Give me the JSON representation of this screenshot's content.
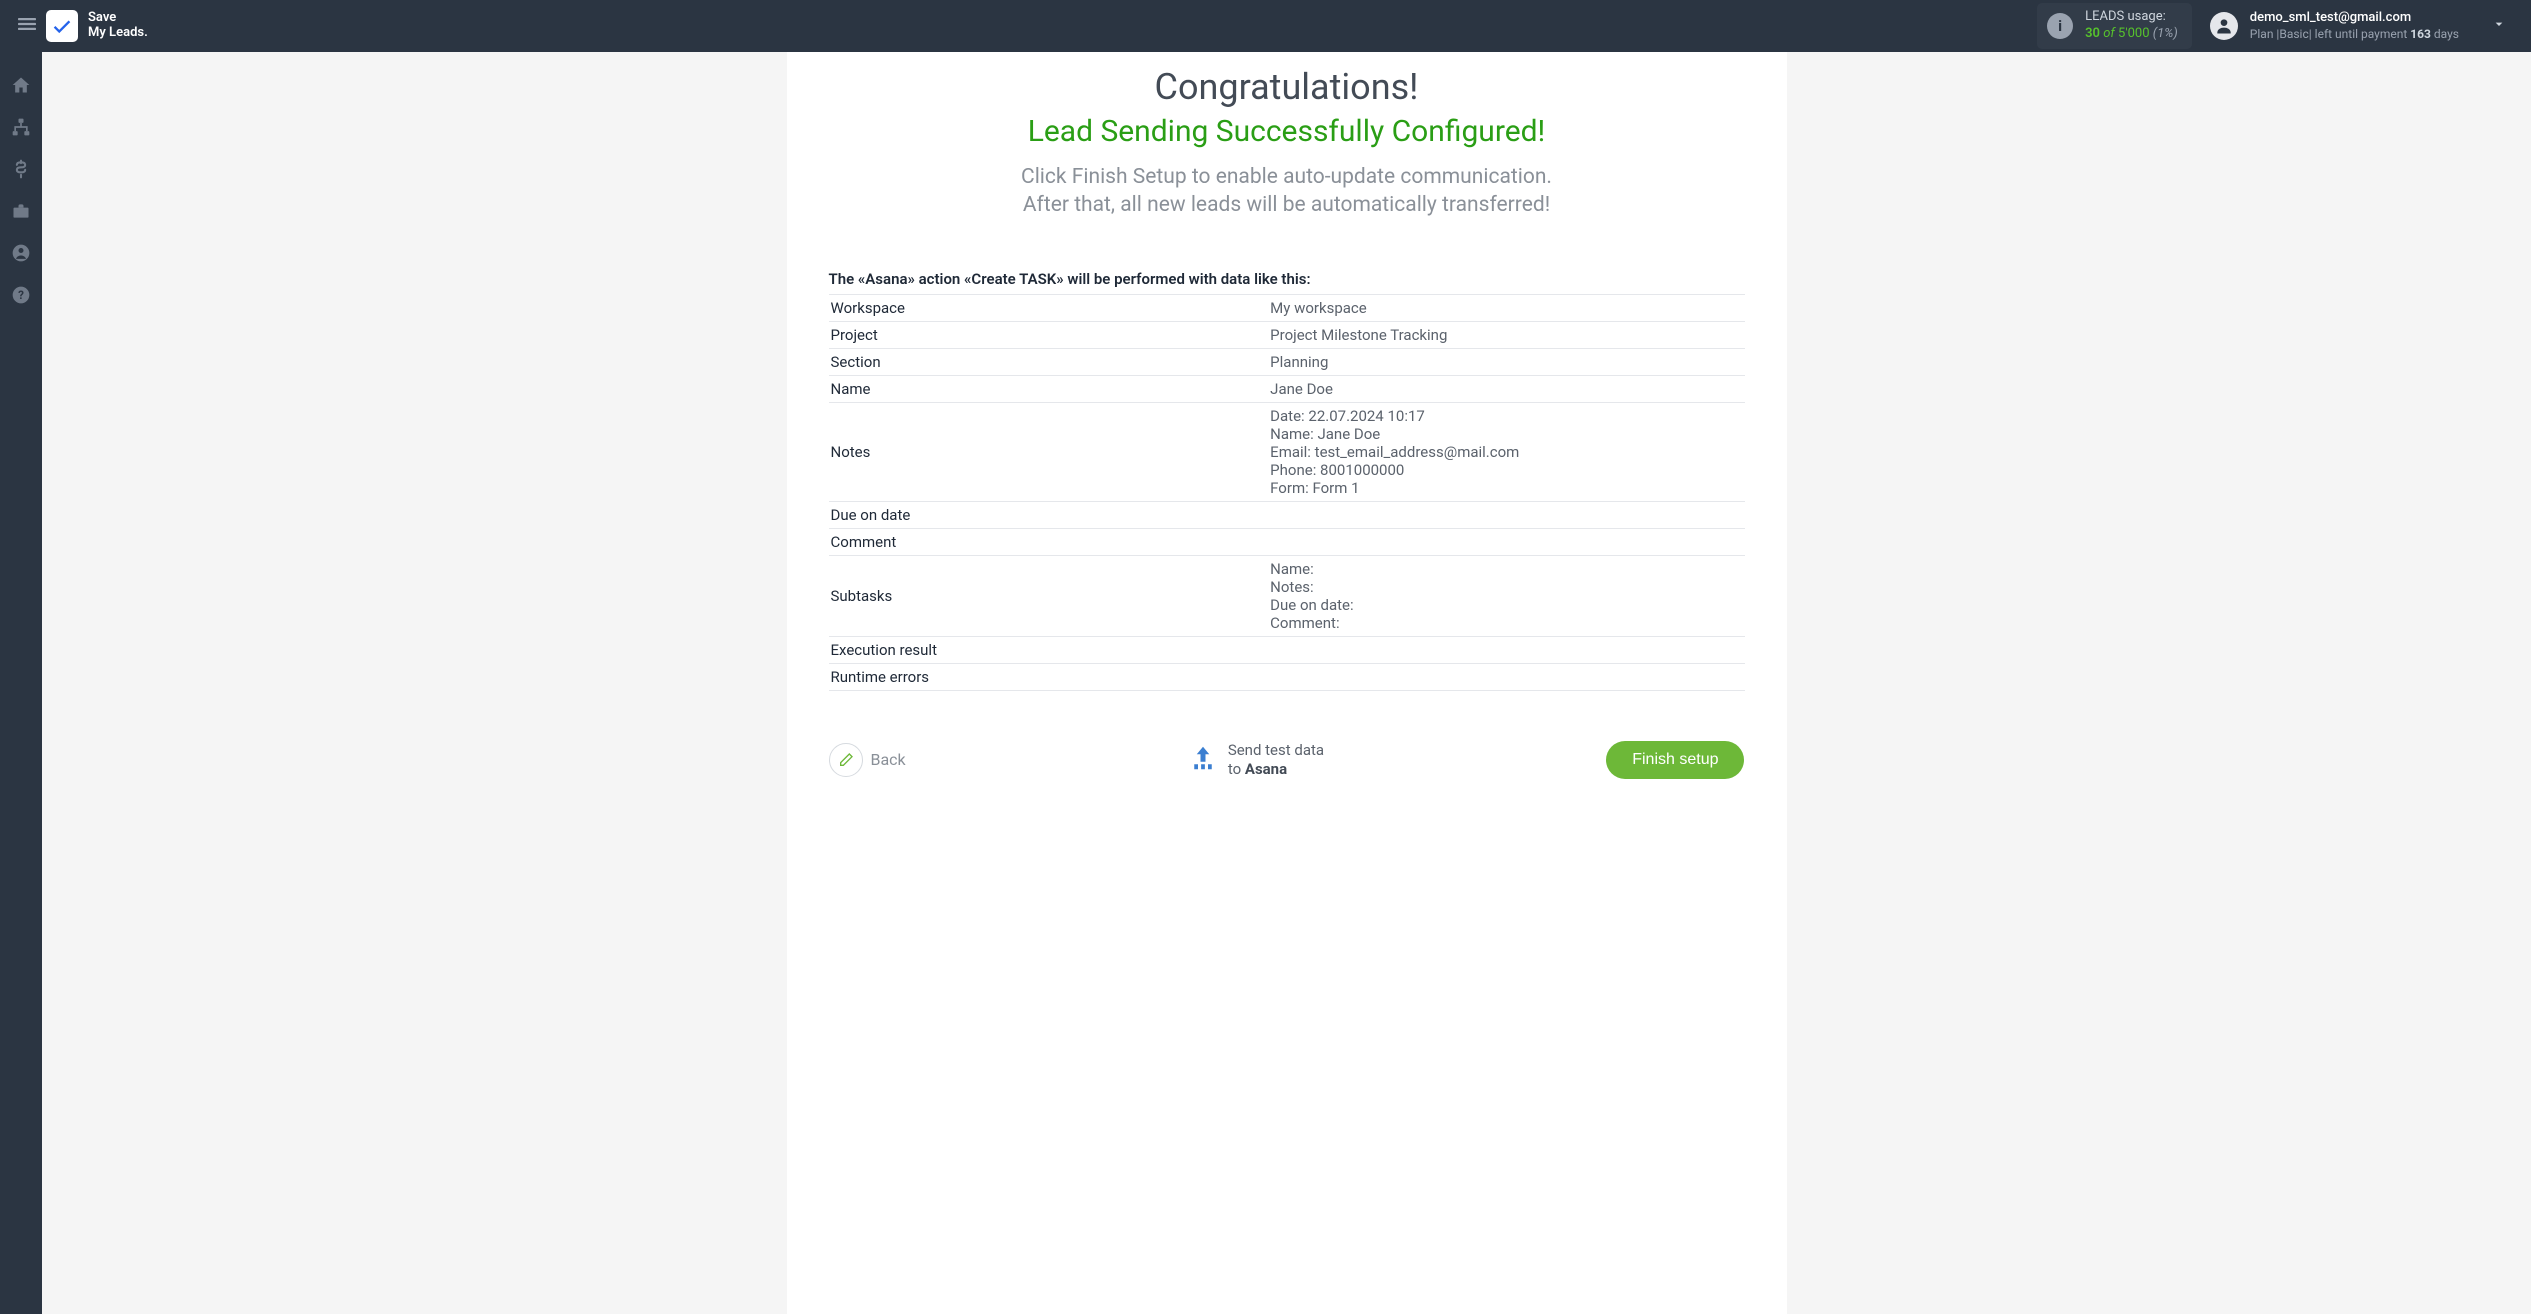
{
  "topbar": {
    "logo_line1": "Save",
    "logo_line2": "My Leads.",
    "usage_label": "LEADS usage:",
    "usage_used": "30",
    "usage_of": "of",
    "usage_total": "5'000",
    "usage_pct": "(1%)",
    "user_email": "demo_sml_test@gmail.com",
    "plan_prefix": "Plan |",
    "plan_name": "Basic",
    "plan_mid": "| left until payment ",
    "plan_days": "163",
    "plan_suffix": " days"
  },
  "main": {
    "congrats": "Congratulations!",
    "success": "Lead Sending Successfully Configured!",
    "instruct_line1": "Click Finish Setup to enable auto-update communication.",
    "instruct_line2": "After that, all new leads will be automatically transferred!",
    "action_desc": "The «Asana» action «Create TASK» will be performed with data like this:"
  },
  "rows": [
    {
      "label": "Workspace",
      "value": "My workspace"
    },
    {
      "label": "Project",
      "value": "Project Milestone Tracking"
    },
    {
      "label": "Section",
      "value": "Planning"
    },
    {
      "label": "Name",
      "value": "Jane Doe"
    },
    {
      "label": "Notes",
      "value": "Date: 22.07.2024 10:17\nName: Jane Doe\nEmail: test_email_address@mail.com\nPhone: 8001000000\nForm: Form 1",
      "multiline": true
    },
    {
      "label": "Due on date",
      "value": ""
    },
    {
      "label": "Comment",
      "value": ""
    },
    {
      "label": "Subtasks",
      "value": "Name:\nNotes:\nDue on date:\nComment:",
      "multiline": true
    },
    {
      "label": "Execution result",
      "value": ""
    },
    {
      "label": "Runtime errors",
      "value": ""
    }
  ],
  "actions": {
    "back": "Back",
    "test_line1": "Send test data",
    "test_line2_prefix": "to ",
    "test_line2_bold": "Asana",
    "finish": "Finish setup"
  }
}
